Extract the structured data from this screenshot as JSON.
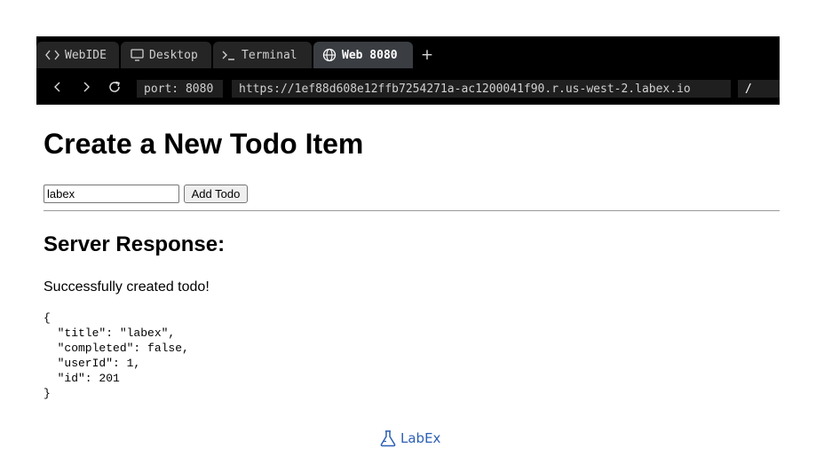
{
  "browser": {
    "tabs": [
      {
        "label": "WebIDE",
        "icon": "code-icon",
        "active": false
      },
      {
        "label": "Desktop",
        "icon": "monitor-icon",
        "active": false
      },
      {
        "label": "Terminal",
        "icon": "terminal-icon",
        "active": false
      },
      {
        "label": "Web 8080",
        "icon": "globe-icon",
        "active": true
      }
    ],
    "add_tab_label": "+",
    "port_label": "port: 8080",
    "url": "https://1ef88d608e12ffb7254271a-ac1200041f90.r.us-west-2.labex.io",
    "path": "/"
  },
  "page": {
    "title": "Create a New Todo Item",
    "input_value": "labex",
    "add_button_label": "Add Todo",
    "response_heading": "Server Response:",
    "status_message": "Successfully created todo!",
    "response_json": "{\n  \"title\": \"labex\",\n  \"completed\": false,\n  \"userId\": 1,\n  \"id\": 201\n}"
  },
  "footer": {
    "brand": "LabEx"
  },
  "colors": {
    "browser_bg": "#000000",
    "active_tab_bg": "#3a3d42",
    "brand_blue": "#2c5fb3"
  }
}
